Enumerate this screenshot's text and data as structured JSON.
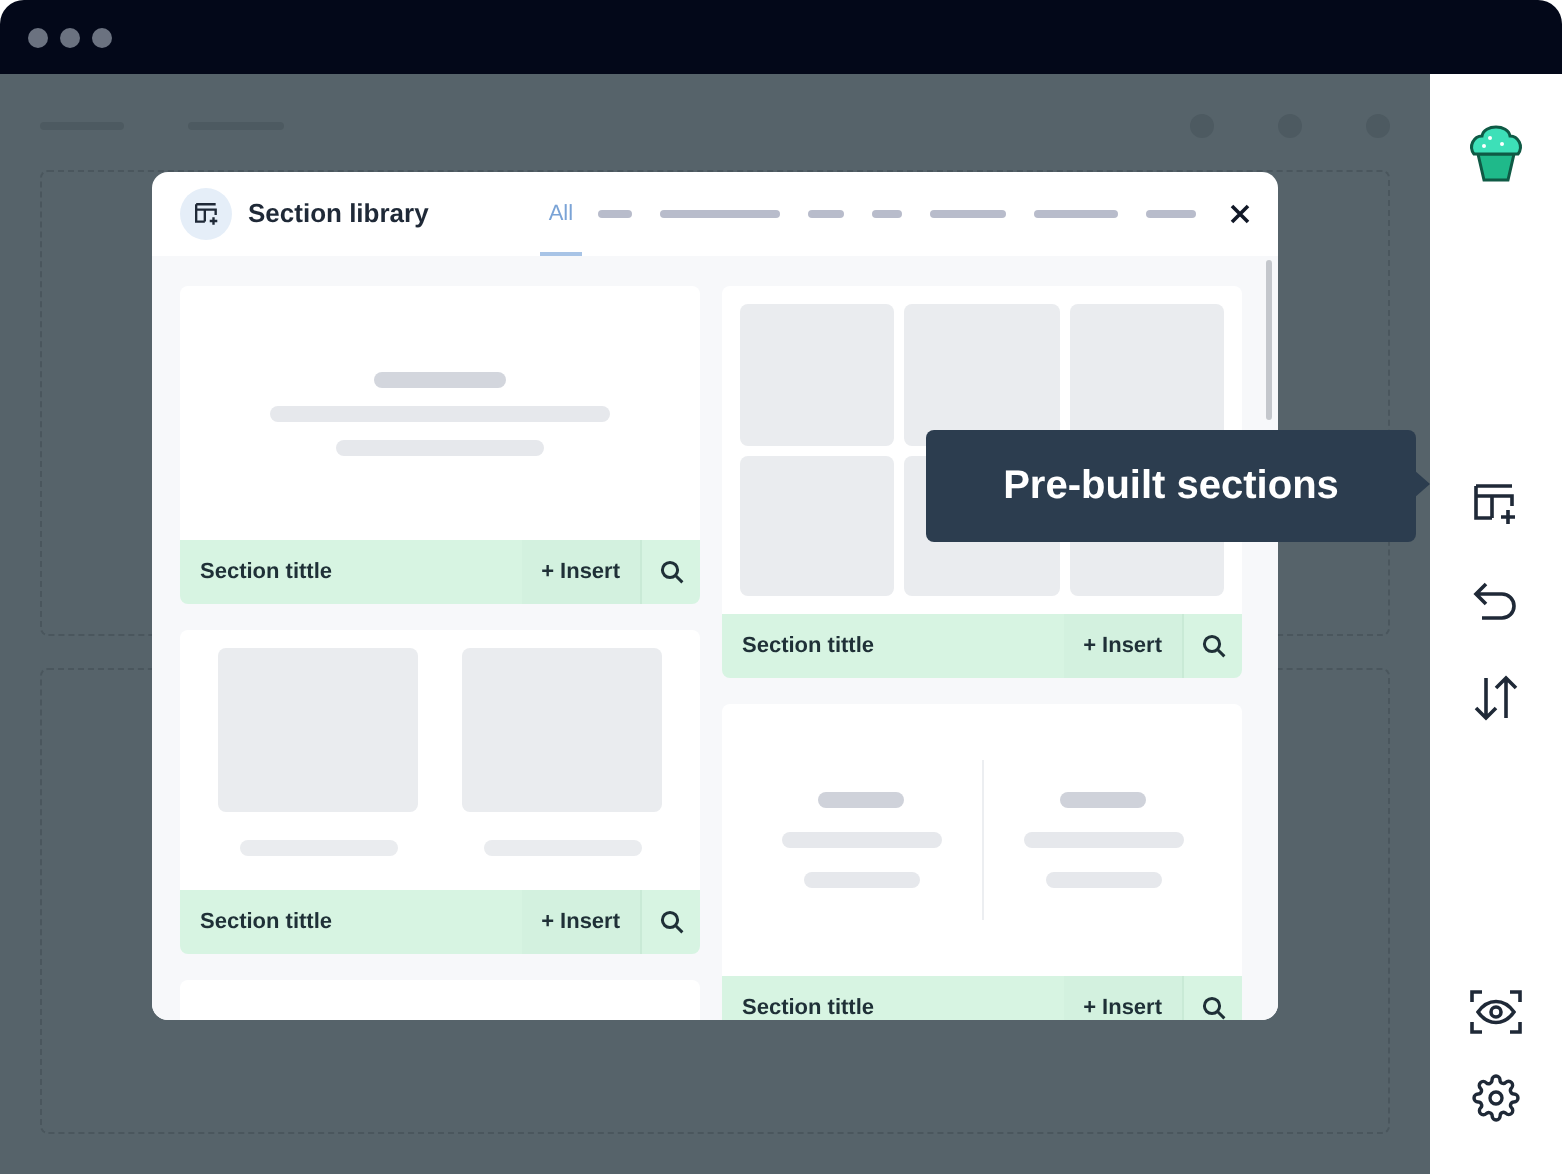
{
  "modal": {
    "title": "Section library",
    "tabs": [
      {
        "label": "All",
        "selected": true
      }
    ],
    "columns": [
      [
        {
          "kind": "text",
          "title": "Section tittle",
          "action": "+ Insert"
        },
        {
          "kind": "two-images",
          "title": "Section tittle",
          "action": "+ Insert"
        },
        {
          "kind": "empty"
        }
      ],
      [
        {
          "kind": "grid",
          "title": "Section tittle",
          "action": "+ Insert"
        },
        {
          "kind": "two-columns",
          "title": "Section tittle",
          "action": "+ Insert"
        }
      ]
    ]
  },
  "tooltip": {
    "text": "Pre-built sections"
  }
}
